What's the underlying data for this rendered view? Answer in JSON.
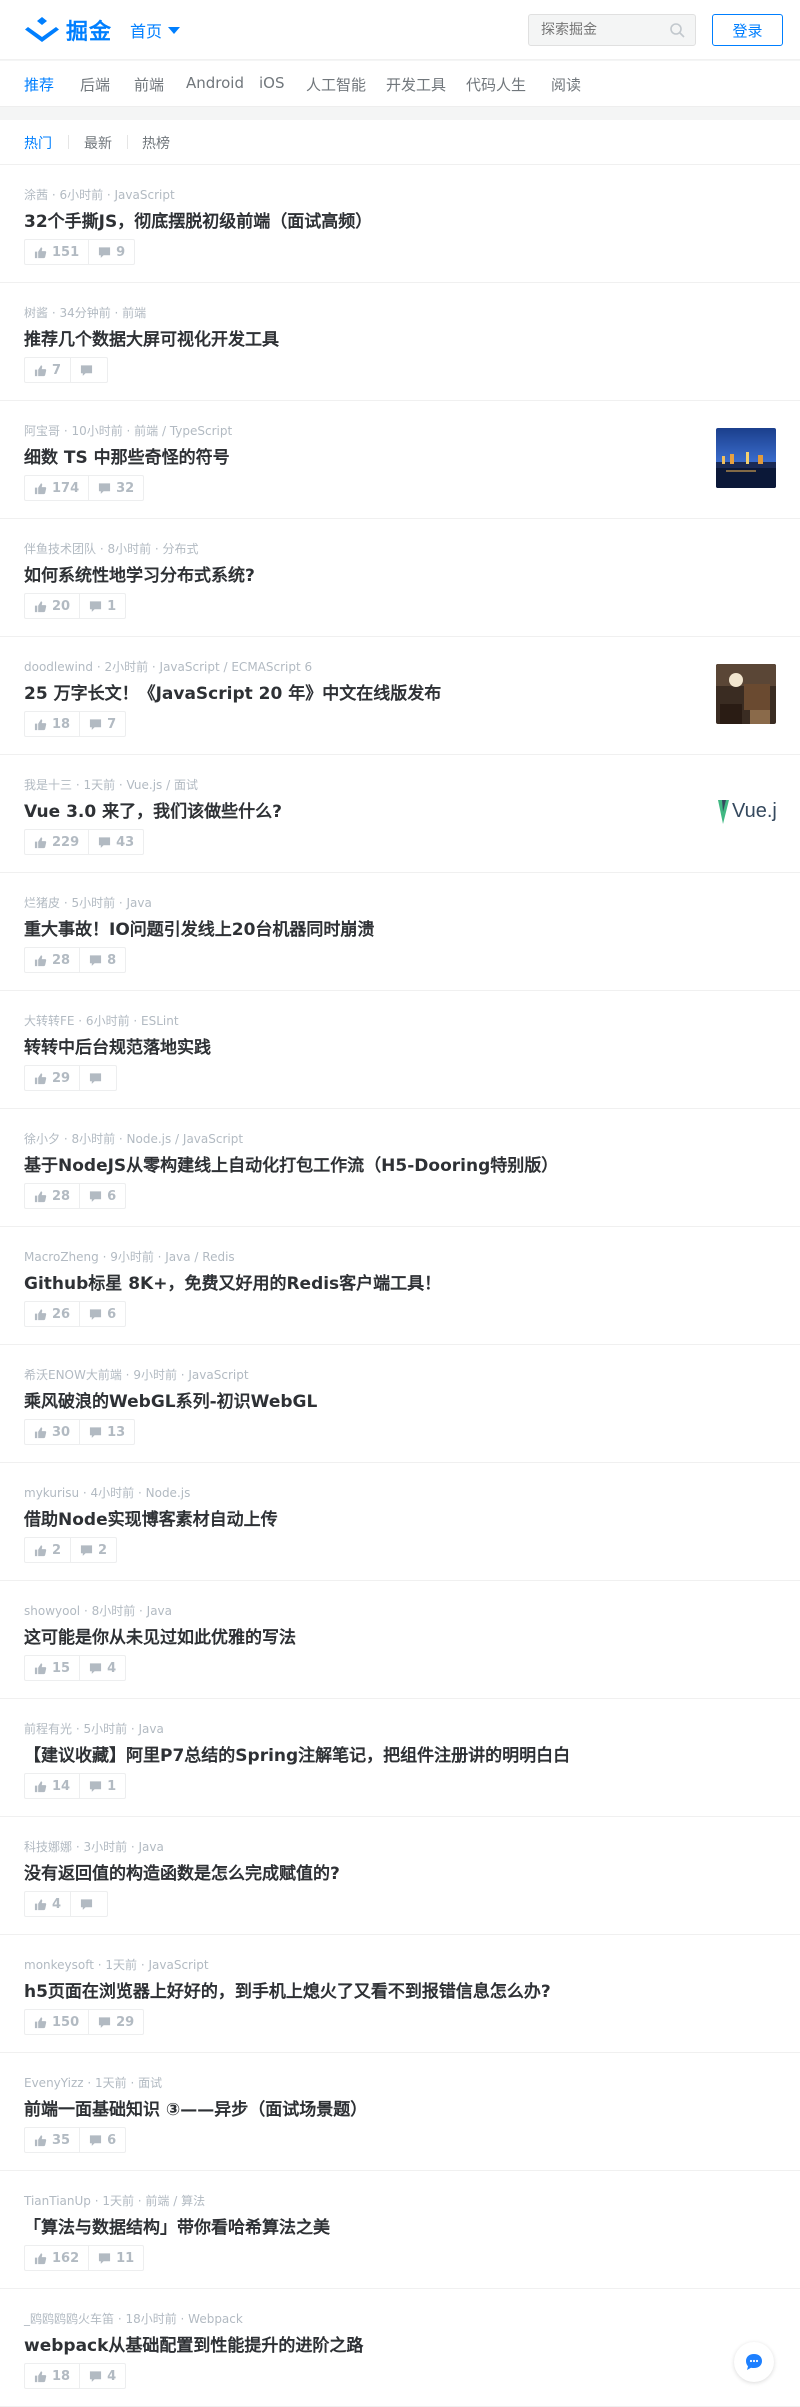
{
  "header": {
    "logo_text": "掘金",
    "home_label": "首页",
    "search_placeholder": "探索掘金",
    "login_label": "登录"
  },
  "nav_tabs": [
    "推荐",
    "后端",
    "前端",
    "Android",
    "iOS",
    "人工智能",
    "开发工具",
    "代码人生",
    "阅读"
  ],
  "sub_tabs": [
    "热门",
    "最新",
    "热榜"
  ],
  "entries": [
    {
      "meta": "涂茜 · 6小时前 · JavaScript",
      "title": "32个手撕JS，彻底摆脱初级前端（面试高频）",
      "likes": "151",
      "comments": "9",
      "thumb": ""
    },
    {
      "meta": "树酱 · 34分钟前 · 前端",
      "title": "推荐几个数据大屏可视化开发工具",
      "likes": "7",
      "comments": "",
      "thumb": ""
    },
    {
      "meta": "阿宝哥 · 10小时前 · 前端 / TypeScript",
      "title": "细数 TS 中那些奇怪的符号",
      "likes": "174",
      "comments": "32",
      "thumb": "city"
    },
    {
      "meta": "伴鱼技术团队 · 8小时前 · 分布式",
      "title": "如何系统性地学习分布式系统?",
      "likes": "20",
      "comments": "1",
      "thumb": ""
    },
    {
      "meta": "doodlewind · 2小时前 · JavaScript / ECMAScript 6",
      "title": "25 万字长文！《JavaScript 20 年》中文在线版发布",
      "likes": "18",
      "comments": "7",
      "thumb": "photo"
    },
    {
      "meta": "我是十三 · 1天前 · Vue.js / 面试",
      "title": "Vue 3.0 来了，我们该做些什么?",
      "likes": "229",
      "comments": "43",
      "thumb": "vue"
    },
    {
      "meta": "烂猪皮 · 5小时前 · Java",
      "title": "重大事故！IO问题引发线上20台机器同时崩溃",
      "likes": "28",
      "comments": "8",
      "thumb": ""
    },
    {
      "meta": "大转转FE · 6小时前 · ESLint",
      "title": "转转中后台规范落地实践",
      "likes": "29",
      "comments": "",
      "thumb": ""
    },
    {
      "meta": "徐小夕 · 8小时前 · Node.js / JavaScript",
      "title": "基于NodeJS从零构建线上自动化打包工作流（H5-Dooring特别版）",
      "likes": "28",
      "comments": "6",
      "thumb": ""
    },
    {
      "meta": "MacroZheng · 9小时前 · Java / Redis",
      "title": "Github标星 8K+，免费又好用的Redis客户端工具！",
      "likes": "26",
      "comments": "6",
      "thumb": ""
    },
    {
      "meta": "希沃ENOW大前端 · 9小时前 · JavaScript",
      "title": "乘风破浪的WebGL系列-初识WebGL",
      "likes": "30",
      "comments": "13",
      "thumb": ""
    },
    {
      "meta": "mykurisu · 4小时前 · Node.js",
      "title": "借助Node实现博客素材自动上传",
      "likes": "2",
      "comments": "2",
      "thumb": ""
    },
    {
      "meta": "showyool · 8小时前 · Java",
      "title": "这可能是你从未见过如此优雅的写法",
      "likes": "15",
      "comments": "4",
      "thumb": ""
    },
    {
      "meta": "前程有光 · 5小时前 · Java",
      "title": "【建议收藏】阿里P7总结的Spring注解笔记，把组件注册讲的明明白白",
      "likes": "14",
      "comments": "1",
      "thumb": ""
    },
    {
      "meta": "科技娜娜 · 3小时前 · Java",
      "title": "没有返回值的构造函数是怎么完成赋值的?",
      "likes": "4",
      "comments": "",
      "thumb": ""
    },
    {
      "meta": "monkeysoft · 1天前 · JavaScript",
      "title": "h5页面在浏览器上好好的，到手机上熄火了又看不到报错信息怎么办?",
      "likes": "150",
      "comments": "29",
      "thumb": ""
    },
    {
      "meta": "EvenyYizz · 1天前 · 面试",
      "title": "前端一面基础知识 ③——异步（面试场景题）",
      "likes": "35",
      "comments": "6",
      "thumb": ""
    },
    {
      "meta": "TianTianUp · 1天前 · 前端 / 算法",
      "title": "「算法与数据结构」带你看哈希算法之美",
      "likes": "162",
      "comments": "11",
      "thumb": ""
    },
    {
      "meta": "_鸥鸥鸥鸥火车笛 · 18小时前 · Webpack",
      "title": "webpack从基础配置到性能提升的进阶之路",
      "likes": "18",
      "comments": "4",
      "thumb": ""
    }
  ],
  "vue_thumb_text": "Vue.j",
  "colors": {
    "accent": "#007fff",
    "text": "#2e3135",
    "muted": "#b2bac2"
  }
}
